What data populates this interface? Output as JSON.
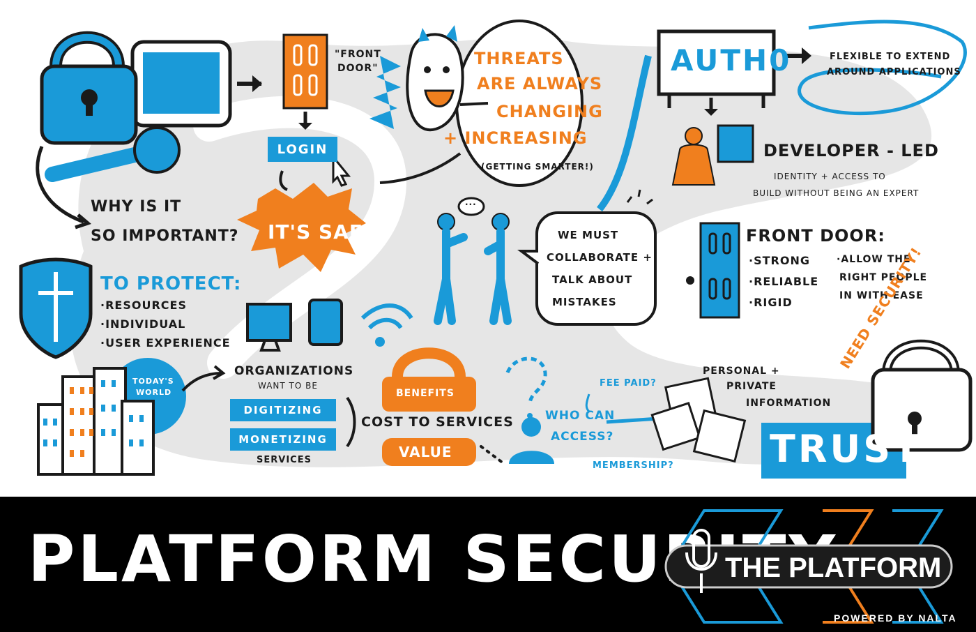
{
  "left": {
    "why_line1": "WHY IS IT",
    "why_line2": "SO IMPORTANT?",
    "protect_title": "TO PROTECT:",
    "protect_items": [
      "·RESOURCES",
      "·INDIVIDUAL",
      "·USER EXPERIENCE"
    ],
    "todays_world_line1": "TODAY'S",
    "todays_world_line2": "WORLD"
  },
  "flow": {
    "front_door_quote_line1": "\"FRONT",
    "front_door_quote_line2": "DOOR\"",
    "login_label": "LOGIN",
    "safe_label": "IT'S SAFE!"
  },
  "threats": {
    "line1": "THREATS",
    "line2": "ARE ALWAYS",
    "line3": "CHANGING",
    "line4": "+ INCREASING",
    "note": "(GETTING SMARTER!)"
  },
  "collab": {
    "line1": "WE MUST",
    "line2": "COLLABORATE +",
    "line3": "TALK ABOUT",
    "line4": "MISTAKES",
    "speech": "···"
  },
  "auth0": {
    "sign_label": "AUTH0",
    "flexible_line1": "FLEXIBLE TO EXTEND",
    "flexible_line2": "AROUND APPLICATIONS",
    "dev_title": "DEVELOPER - LED",
    "dev_line1": "IDENTITY + ACCESS TO",
    "dev_line2": "BUILD WITHOUT BEING AN EXPERT"
  },
  "front_door": {
    "title": "FRONT DOOR:",
    "qualities": [
      "·STRONG",
      "·RELIABLE",
      "·RIGID"
    ],
    "allow_line1": "·ALLOW THE",
    "allow_line2": "RIGHT PEOPLE",
    "allow_line3": "IN WITH EASE"
  },
  "organizations": {
    "line1": "ORGANIZATIONS",
    "line2": "WANT TO BE",
    "digitizing": "DIGITIZING",
    "monetizing": "MONETIZING",
    "services": "SERVICES"
  },
  "value": {
    "benefits": "BENEFITS",
    "cost": "COST TO SERVICES",
    "value": "VALUE"
  },
  "access": {
    "fee_paid": "FEE PAID?",
    "who_line1": "WHO CAN",
    "who_line2": "ACCESS?",
    "membership": "MEMBERSHIP?"
  },
  "trust": {
    "personal_line1": "PERSONAL +",
    "personal_line2": "PRIVATE",
    "personal_line3": "INFORMATION",
    "need_security": "NEED SECURITY!",
    "trust_label": "TRUST"
  },
  "banner": {
    "title": "PLATFORM SECURITY",
    "brand": "THE PLATFORM",
    "powered_by": "POWERED BY NALTA"
  },
  "colors": {
    "blue": "#1a9ad8",
    "orange": "#f07f1e",
    "ink": "#1a1a1a",
    "path_gray": "#e6e6e6",
    "banner_bg": "#000000"
  }
}
